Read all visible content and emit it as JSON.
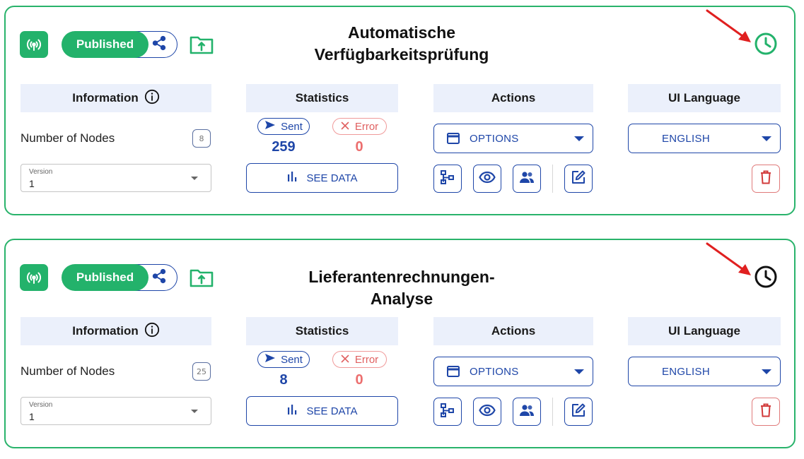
{
  "colors": {
    "brand_green": "#23b26b",
    "primary_blue": "#1e46a8",
    "error_red": "#e06060",
    "header_bg": "#ebf0fb",
    "annotation_arrow": "#e02020"
  },
  "cards": [
    {
      "status_label": "Published",
      "title_line1": "Automatische",
      "title_line2": "Verfügbarkeitsprüfung",
      "clock_icon_color": "#23b26b",
      "sections": {
        "information": "Information",
        "statistics": "Statistics",
        "actions": "Actions",
        "ui_language": "UI Language"
      },
      "number_of_nodes_label": "Number of Nodes",
      "number_of_nodes": "8",
      "version": {
        "caption": "Version",
        "value": "1"
      },
      "sent_label": "Sent",
      "error_label": "Error",
      "sent_count": "259",
      "error_count": "0",
      "see_data_label": "SEE DATA",
      "options_label": "OPTIONS",
      "language_label": "ENGLISH",
      "icons": [
        "wifi-signal-icon",
        "share-icon",
        "folder-upload-icon",
        "clock-icon",
        "info-icon",
        "send-icon",
        "close-x-icon",
        "bar-chart-icon",
        "window-icon",
        "caret-down-icon",
        "tree-diagram-icon",
        "eye-icon",
        "users-icon",
        "edit-icon",
        "trash-icon"
      ]
    },
    {
      "status_label": "Published",
      "title_line1": "Lieferantenrechnungen-Analyse",
      "title_line2": "",
      "clock_icon_color": "#111111",
      "sections": {
        "information": "Information",
        "statistics": "Statistics",
        "actions": "Actions",
        "ui_language": "UI Language"
      },
      "number_of_nodes_label": "Number of Nodes",
      "number_of_nodes": "25",
      "version": {
        "caption": "Version",
        "value": "1"
      },
      "sent_label": "Sent",
      "error_label": "Error",
      "sent_count": "8",
      "error_count": "0",
      "see_data_label": "SEE DATA",
      "options_label": "OPTIONS",
      "language_label": "ENGLISH",
      "icons": [
        "wifi-signal-icon",
        "share-icon",
        "folder-upload-icon",
        "clock-icon",
        "info-icon",
        "send-icon",
        "close-x-icon",
        "bar-chart-icon",
        "window-icon",
        "caret-down-icon",
        "tree-diagram-icon",
        "eye-icon",
        "users-icon",
        "edit-icon",
        "trash-icon"
      ]
    }
  ]
}
